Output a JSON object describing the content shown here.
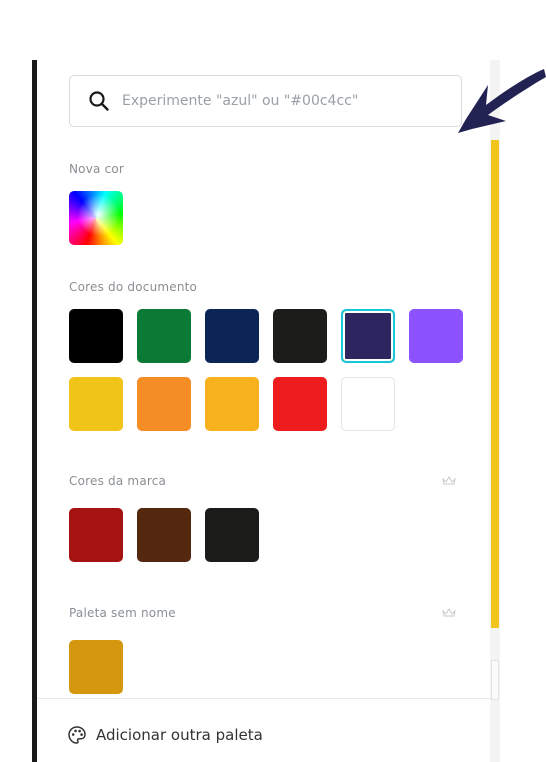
{
  "search": {
    "placeholder": "Experimente \"azul\" ou \"#00c4cc\""
  },
  "sections": {
    "new_color": {
      "label": "Nova cor"
    },
    "document": {
      "label": "Cores do documento",
      "colors": [
        "#000000",
        "#0b7a35",
        "#0c2557",
        "#1c1c1a",
        "#2b2560",
        "#8c52ff",
        "#f0c419",
        "#f58d26",
        "#f7b21e",
        "#ee1c1c",
        "#ffffff"
      ],
      "selected_index": 4
    },
    "brand": {
      "label": "Cores da marca",
      "icon": "crown-icon",
      "colors": [
        "#a51313",
        "#53280f",
        "#1b1b1a"
      ]
    },
    "unnamed_palette": {
      "label": "Paleta sem nome",
      "icon": "crown-icon",
      "colors": [
        "#d4970f"
      ]
    }
  },
  "footer": {
    "label": "Adicionar outra paleta",
    "icon": "palette-icon"
  },
  "annotation": {
    "color": "#232353",
    "icon": "arrow-icon"
  },
  "scroll": {
    "thumb_color": "#f1c51c"
  }
}
